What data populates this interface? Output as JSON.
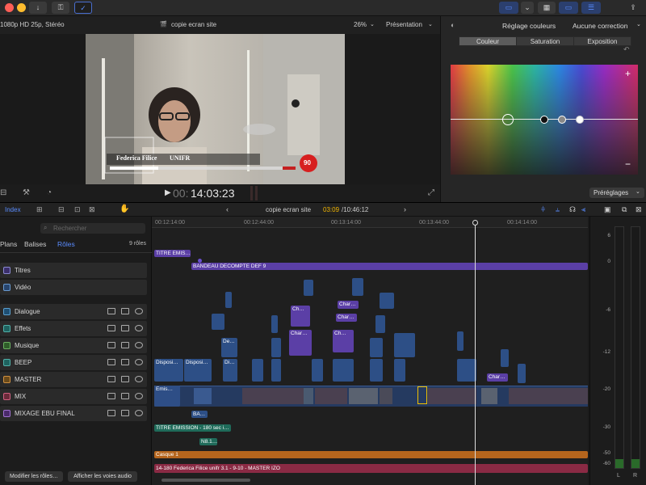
{
  "viewer": {
    "format": "1080p HD 25p, Stéréo",
    "title": "copie ecran site",
    "zoom": "26%",
    "presentation": "Présentation",
    "timecode_prefix": "00:",
    "timecode": "14:03:23",
    "lower_third_name": "Federica Filice",
    "lower_third_org": "UNIFR",
    "countdown": "90"
  },
  "inspector": {
    "title": "Réglage couleurs",
    "correction": "Aucune correction",
    "tabs": [
      "Couleur",
      "Saturation",
      "Exposition"
    ],
    "selected_tab": "Couleur",
    "presets": "Préréglages",
    "plus": "+",
    "minus": "−"
  },
  "timeline_bar": {
    "index": "Index",
    "project": "copie ecran site",
    "position": "03:09",
    "duration": "/10:46:12"
  },
  "index_panel": {
    "search_placeholder": "Rechercher",
    "tabs": [
      "Plans",
      "Balises",
      "Rôles"
    ],
    "active_tab": "Rôles",
    "count": "9 rôles",
    "video_roles": [
      "Titres",
      "Vidéo"
    ],
    "audio_roles": [
      "Dialogue",
      "Effets",
      "Musique",
      "BEEP",
      "MASTER",
      "MIX",
      "MIXAGE EBU FINAL"
    ],
    "edit_roles_button": "Modifier les rôles…",
    "show_lanes_button": "Afficher les voies audio"
  },
  "ruler": {
    "ticks": [
      "00:12:14:00",
      "00:12:44:00",
      "00:13:14:00",
      "00:13:44:00",
      "00:14:14:00"
    ]
  },
  "clips": {
    "titre": "TITRE EMIS…",
    "bandeau": "BANDEAU DECOMPTE DEF 9",
    "ch1": "Ch…",
    "ch2": "Char…",
    "ch3": "Char…",
    "ch4": "Ch…",
    "ch5": "Char…",
    "ch6": "Char…",
    "de": "De…",
    "dispo1": "Disposi…",
    "dispo2": "Disposi…",
    "di": "Di…",
    "ba": "BA…",
    "titre_emission": "TITRE EMISSION - 180 sec i…",
    "n": "N8.1…",
    "casque": "Casque 1",
    "master": "14-180 Federica Filice unifr 3.1 - 9-10 - MASTER IZO",
    "emis": "Emis…"
  },
  "meters": {
    "scale": [
      "6",
      "0",
      "-6",
      "-12",
      "-20",
      "-30",
      "-50",
      "-60"
    ],
    "left": "L",
    "right": "R"
  }
}
